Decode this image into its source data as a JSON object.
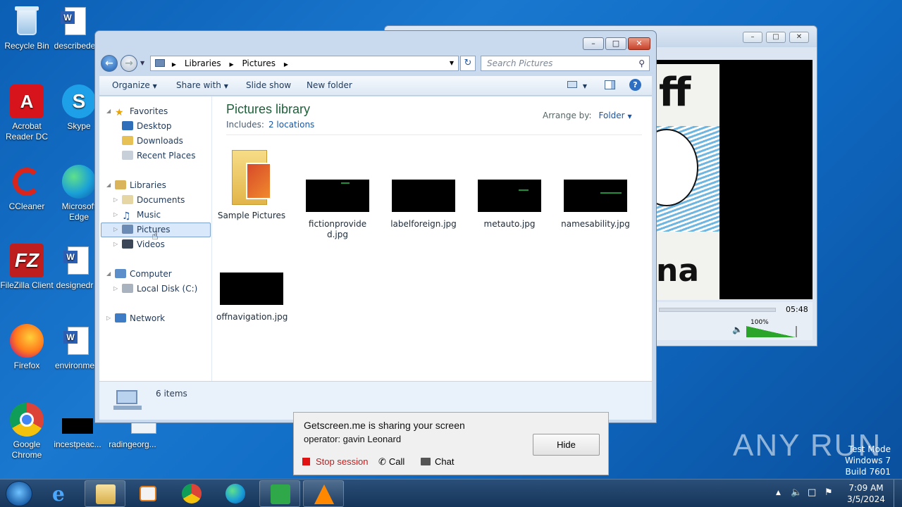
{
  "desktop": {
    "icons": [
      {
        "label": "Recycle Bin",
        "icon": "recycle-bin-icon"
      },
      {
        "label": "describede",
        "icon": "word-doc-icon"
      },
      {
        "label": "Acrobat Reader DC",
        "icon": "acrobat-icon"
      },
      {
        "label": "Skype",
        "icon": "skype-icon"
      },
      {
        "label": "CCleaner",
        "icon": "ccleaner-icon"
      },
      {
        "label": "Microsoft Edge",
        "icon": "edge-icon"
      },
      {
        "label": "FileZilla Client",
        "icon": "filezilla-icon"
      },
      {
        "label": "designedr",
        "icon": "word-doc-icon"
      },
      {
        "label": "Firefox",
        "icon": "firefox-icon"
      },
      {
        "label": "environme",
        "icon": "word-doc-icon"
      },
      {
        "label": "Google Chrome",
        "icon": "chrome-icon"
      },
      {
        "label": "incestpeac...",
        "icon": "image-file-icon"
      },
      {
        "label": "radingeorg...",
        "icon": "file-icon"
      }
    ]
  },
  "media": {
    "time": "05:48",
    "volume": "100%",
    "volume_level": 1.0
  },
  "explorer": {
    "breadcrumb": [
      "Libraries",
      "Pictures"
    ],
    "search_placeholder": "Search Pictures",
    "toolbar": {
      "organize": "Organize",
      "share_with": "Share with",
      "slide_show": "Slide show",
      "new_folder": "New folder"
    },
    "nav": {
      "favorites": "Favorites",
      "desktop": "Desktop",
      "downloads": "Downloads",
      "recent_places": "Recent Places",
      "libraries": "Libraries",
      "documents": "Documents",
      "music": "Music",
      "pictures": "Pictures",
      "videos": "Videos",
      "computer": "Computer",
      "local_disk": "Local Disk (C:)",
      "network": "Network"
    },
    "library": {
      "title": "Pictures library",
      "includes_label": "Includes:",
      "locations": "2 locations",
      "arrange_label": "Arrange by:",
      "arrange_value": "Folder"
    },
    "files": [
      {
        "name": "Sample Pictures",
        "type": "folder"
      },
      {
        "name": "fictionprovided.jpg",
        "type": "image"
      },
      {
        "name": "labelforeign.jpg",
        "type": "image"
      },
      {
        "name": "metauto.jpg",
        "type": "image"
      },
      {
        "name": "namesability.jpg",
        "type": "image"
      },
      {
        "name": "offnavigation.jpg",
        "type": "image"
      }
    ],
    "item_count": "6 items"
  },
  "share_popup": {
    "title": "Getscreen.me is sharing your screen",
    "operator": "operator: gavin Leonard",
    "hide": "Hide",
    "stop": "Stop session",
    "call": "Call",
    "chat": "Chat"
  },
  "watermark": {
    "brand": "ANY RUN",
    "mode": "Test Mode",
    "os": "Windows 7",
    "build": "Build 7601"
  },
  "taskbar": {
    "time": "7:09 AM",
    "date": "3/5/2024",
    "apps": [
      "ie-icon",
      "explorer-icon",
      "media-player-icon",
      "chrome-icon",
      "edge-icon",
      "getscreen-icon",
      "vlc-icon"
    ]
  },
  "colors": {
    "desktop_blue": "#1a78cf",
    "library_title": "#1e5f3a",
    "link_blue": "#1a56a3",
    "stop_red": "#c41b1b"
  }
}
